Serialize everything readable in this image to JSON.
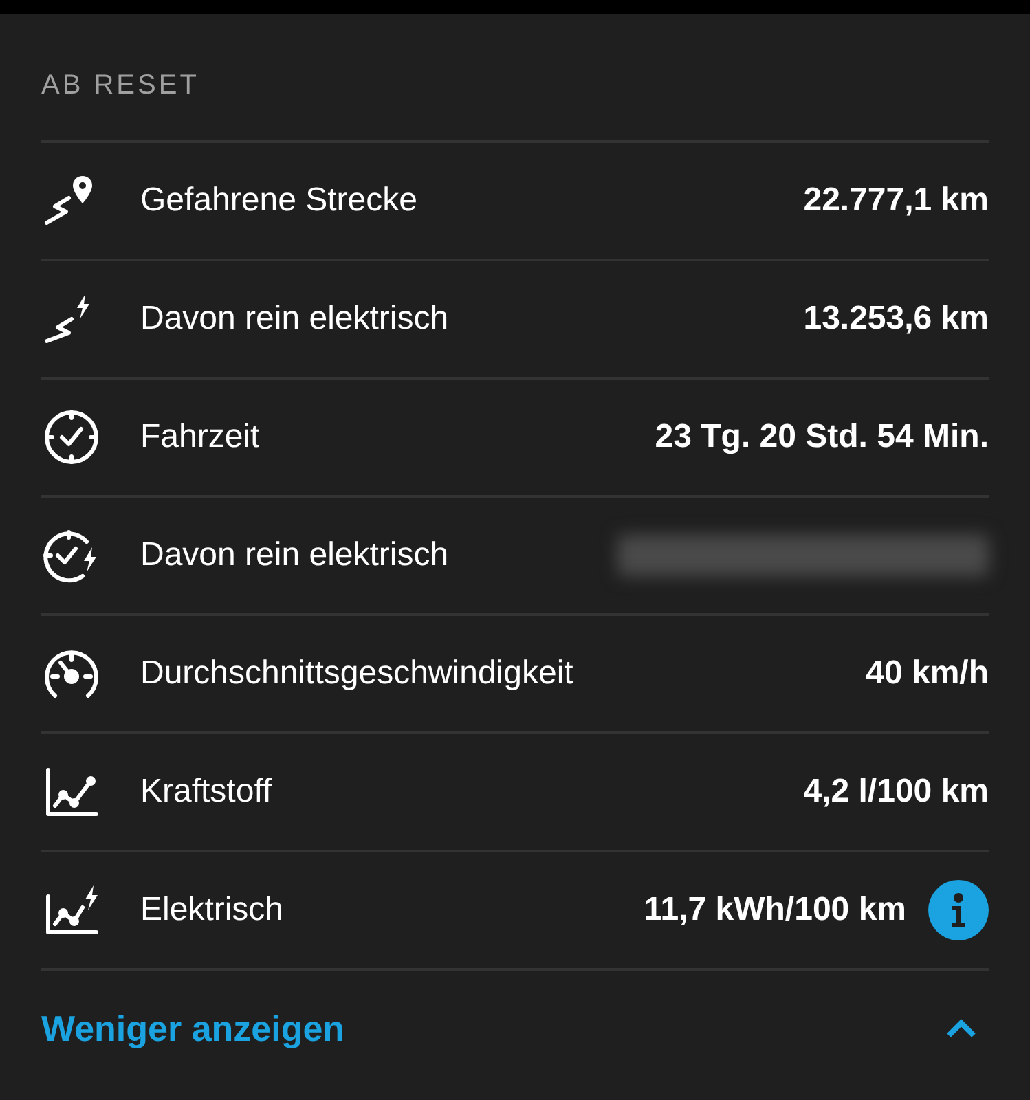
{
  "section_title": "AB RESET",
  "rows": [
    {
      "kind": "route",
      "label": "Gefahrene Strecke",
      "value": "22.777,1 km",
      "blurred": false,
      "info": false
    },
    {
      "kind": "route_electric",
      "label": "Davon rein elektrisch",
      "value": "13.253,6 km",
      "blurred": false,
      "info": false
    },
    {
      "kind": "clock",
      "label": "Fahrzeit",
      "value": "23 Tg. 20 Std. 54 Min.",
      "blurred": false,
      "info": false
    },
    {
      "kind": "clock_electric",
      "label": "Davon rein elektrisch",
      "blurred": true,
      "info": false
    },
    {
      "kind": "gauge",
      "label": "Durchschnittsgeschwindigkeit",
      "value": "40 km/h",
      "blurred": false,
      "info": false
    },
    {
      "kind": "chart",
      "label": "Kraftstoff",
      "value": "4,2 l/100 km",
      "blurred": false,
      "info": false
    },
    {
      "kind": "chart_electric",
      "label": "Elektrisch",
      "value": "11,7 kWh/100 km",
      "blurred": false,
      "info": true
    }
  ],
  "toggle": {
    "label": "Weniger anzeigen",
    "expanded": true
  }
}
